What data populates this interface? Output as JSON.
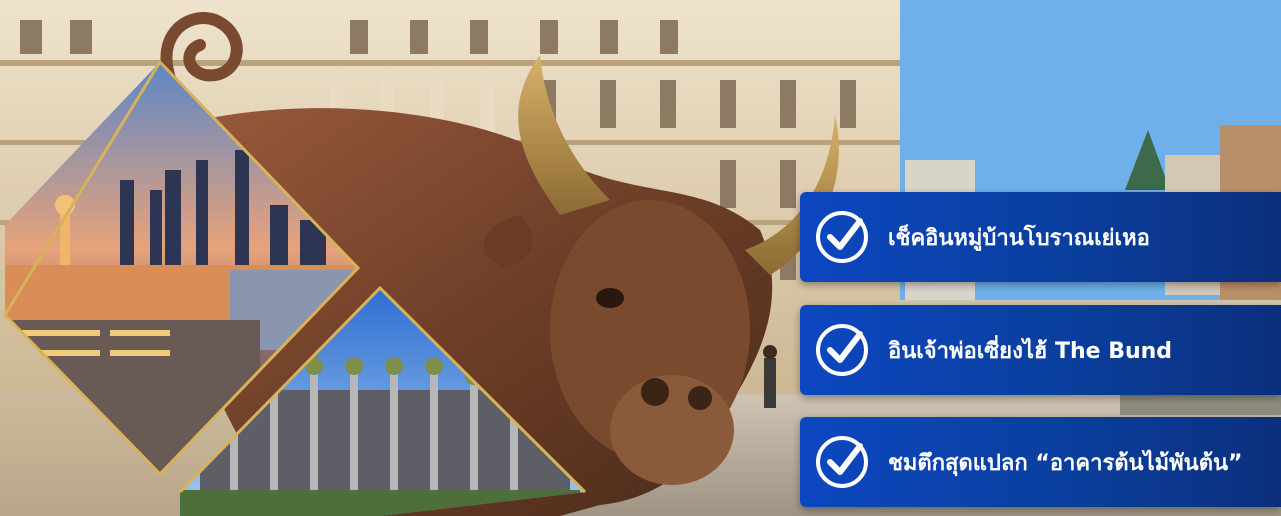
{
  "banner": {
    "tags": [
      {
        "icon": "check-circle-icon",
        "label": "เช็คอินหมู่บ้านโบราณเย่เหอ"
      },
      {
        "icon": "check-circle-icon",
        "label": "อินเจ้าพ่อเซี่ยงไฮ้ The Bund"
      },
      {
        "icon": "check-circle-icon",
        "label": "ชมตึกสุดแปลก “อาคารต้นไม้พันต้น”"
      }
    ],
    "colors": {
      "tag_bg": "#0a3f9e",
      "tag_text": "#ffffff",
      "frame_gold": "#d8b25a"
    }
  }
}
